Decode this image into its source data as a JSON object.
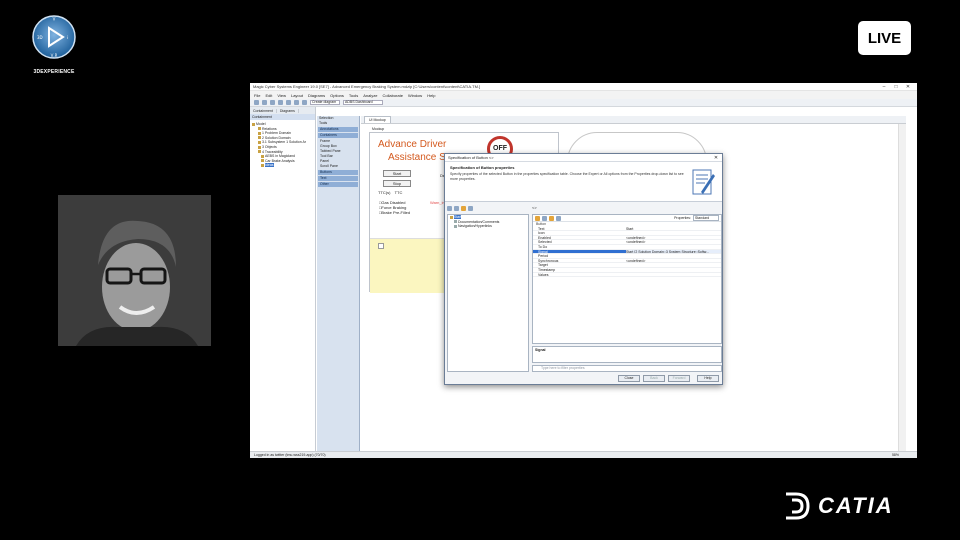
{
  "brand": {
    "platform": "3DEXPERIENCE",
    "product": "CATIA",
    "live": "LIVE"
  },
  "app": {
    "title": "Magic Cyber Systems Engineer 19.0 [SE7] - Advanced Emergency Braking System.mdzip [C:\\Users\\content\\content\\CATIA.TM.]",
    "menus": [
      "File",
      "Edit",
      "View",
      "Layout",
      "Diagrams",
      "Options",
      "Tools",
      "Analyze",
      "Collaborate",
      "Window",
      "Help"
    ],
    "toolbar_box": "ADBS Dashboard",
    "toolbar_create": "Create diagram",
    "status_left": "Logged in as twitter (tmu-wss219-app) (70/70)",
    "zoom": "58%"
  },
  "containment": {
    "tabs": [
      "Containment",
      "Diagrams"
    ],
    "header": "Containment",
    "tree": [
      {
        "label": "Model",
        "depth": 0
      },
      {
        "label": "Relations",
        "depth": 1
      },
      {
        "label": "1 Problem Domain",
        "depth": 1
      },
      {
        "label": "2 Solution Domain",
        "depth": 1
      },
      {
        "label": "3.1 Subsystem 1 Solution Ar",
        "depth": 1
      },
      {
        "label": "3 Objects",
        "depth": 1
      },
      {
        "label": "4 Traceability",
        "depth": 1
      },
      {
        "label": "AEBS in Magicland",
        "depth": 1
      },
      {
        "label": "Car Brake Analysis",
        "depth": 1
      },
      {
        "label": "Ideas",
        "depth": 1,
        "selected": true
      }
    ]
  },
  "palette": {
    "title": "Selection",
    "tools_title": "Tools",
    "groups": [
      "Annotations",
      "Containers",
      "Buttons",
      "Text",
      "Other"
    ],
    "items": [
      "Frame",
      "Group Box",
      "Tabbed Pane",
      "Tool Bar",
      "Panel",
      "Scroll Pane"
    ]
  },
  "diagram": {
    "tab": "UI Mockup",
    "mockup_label": "Mockup",
    "title_line1": "Advance Driver",
    "title_line2": "Assistance S",
    "btn_start": "Start",
    "btn_stop": "Stop",
    "ttc_label": "TTC(s)",
    "ttc_value": "TTC",
    "checkboxes": [
      "Gas Disabled",
      "Force Braking",
      "Brake Pre-Filled"
    ],
    "warning": "Warn_indi",
    "off_label": "OFF",
    "side_text": "Defi"
  },
  "dialog": {
    "title": "Specification of Button <>",
    "heading": "Specification of Button properties",
    "description": "Specify properties of the selected Button in the properties specification table. Choose the Expert or All options from the Properties drop-down list to see more properties.",
    "tree": [
      {
        "label": "Start",
        "selected": true
      },
      {
        "label": "Documentation/Comments"
      },
      {
        "label": "Navigation/Hyperlinks"
      }
    ],
    "path_label": "<>",
    "properties_label": "Properties:",
    "properties_mode": "Standard",
    "category": "Button",
    "props": [
      {
        "k": "Text",
        "v": "Start"
      },
      {
        "k": "Icon",
        "v": ""
      },
      {
        "k": "Enabled",
        "v": "<undefined>"
      },
      {
        "k": "Selected",
        "v": "<undefined>"
      },
      {
        "k": "To Do",
        "v": ""
      },
      {
        "k": "Signal",
        "v": "Start [2 Solution Domain::3 System Structure::Softw...",
        "selected": true
      },
      {
        "k": "Period",
        "v": ""
      },
      {
        "k": "Synchronous",
        "v": "<undefined>"
      },
      {
        "k": "Target",
        "v": ""
      },
      {
        "k": "Timestamp",
        "v": ""
      },
      {
        "k": "Values",
        "v": ""
      }
    ],
    "desc_label": "Signal",
    "filter_placeholder": "Type here to filter properties",
    "buttons": {
      "close": "Close",
      "back": "Back",
      "forward": "Forward",
      "help": "Help"
    }
  }
}
